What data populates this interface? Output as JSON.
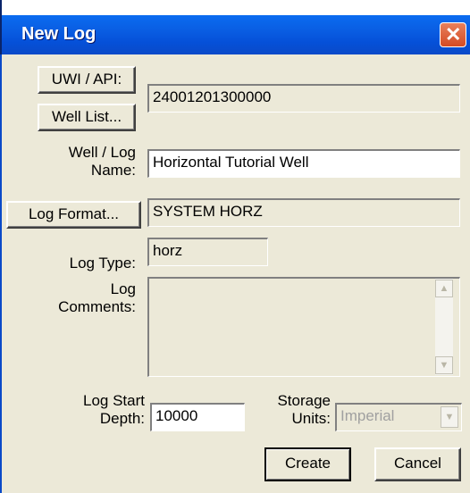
{
  "window": {
    "title": "New Log"
  },
  "buttons": {
    "uwi_api": "UWI / API:",
    "well_list": "Well List...",
    "log_format": "Log Format...",
    "create": "Create",
    "cancel": "Cancel"
  },
  "labels": {
    "well_log_name_1": "Well / Log",
    "well_log_name_2": "Name:",
    "log_type": "Log Type:",
    "log_comments_1": "Log",
    "log_comments_2": "Comments:",
    "log_start_depth_1": "Log Start",
    "log_start_depth_2": "Depth:",
    "storage_units_1": "Storage",
    "storage_units_2": "Units:"
  },
  "fields": {
    "uwi_value": "24001201300000",
    "well_log_name": "Horizontal Tutorial Well",
    "log_format": "SYSTEM HORZ",
    "log_type": "horz",
    "log_comments": "",
    "log_start_depth": "10000",
    "storage_units": "Imperial"
  },
  "colors": {
    "title_bar": "#0a5fe4",
    "dialog_bg": "#ece9d8",
    "close_button": "#d44b24"
  },
  "icons": {
    "close": "close-icon",
    "scroll_up": "scroll-up-arrow-icon",
    "scroll_down": "scroll-down-arrow-icon",
    "dropdown": "dropdown-arrow-icon"
  }
}
